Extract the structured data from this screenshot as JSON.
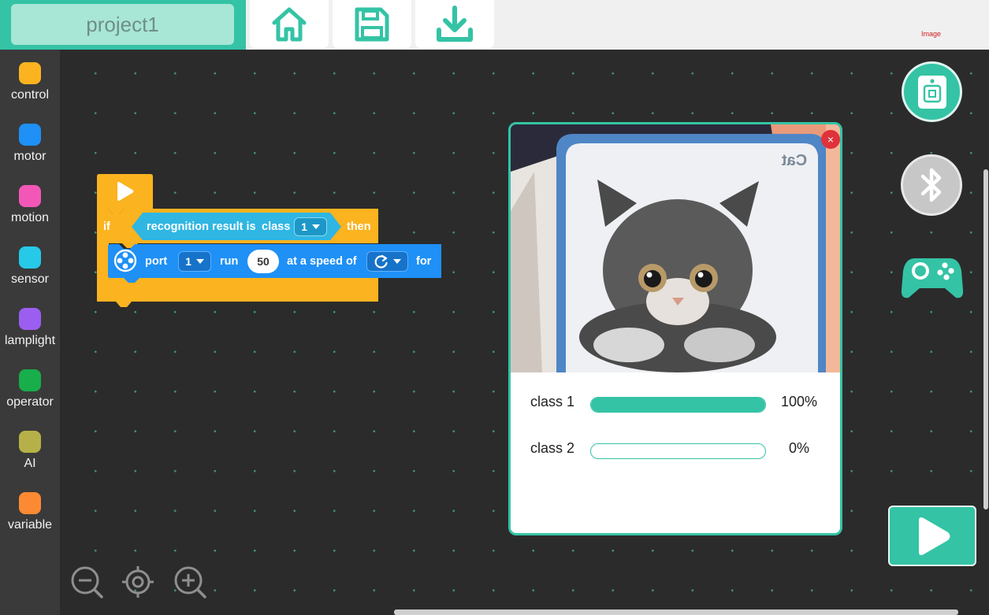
{
  "header": {
    "project_name": "project1",
    "buttons": [
      "home-icon",
      "save-icon",
      "download-icon"
    ],
    "corner_label": "Image"
  },
  "sidebar": {
    "categories": [
      {
        "label": "control",
        "color": "#fbb31f"
      },
      {
        "label": "motor",
        "color": "#1e90f6"
      },
      {
        "label": "motion",
        "color": "#f257b8"
      },
      {
        "label": "sensor",
        "color": "#26c9e8"
      },
      {
        "label": "lamplight",
        "color": "#9c5ef0"
      },
      {
        "label": "operator",
        "color": "#17ae4b"
      },
      {
        "label": "AI",
        "color": "#b5b148"
      },
      {
        "label": "variable",
        "color": "#fc8a33"
      }
    ]
  },
  "blocks": {
    "if_label": "if",
    "condition": "recognition result is",
    "class_word": "class",
    "class_value": "1",
    "then_label": "then",
    "motor": {
      "port_label": "port",
      "port_value": "1",
      "run_label": "run",
      "run_value": "50",
      "speed_label": "at a speed of",
      "for_label": "for"
    }
  },
  "recognition": {
    "card_text": "Cat",
    "close_symbol": "×",
    "results": [
      {
        "label": "class 1",
        "percent_text": "100%",
        "fill": 1.0
      },
      {
        "label": "class 2",
        "percent_text": "0%",
        "fill": 0.0
      }
    ]
  },
  "colors": {
    "accent": "#34c3a5",
    "control_block": "#fbb31f",
    "motor_block": "#1e90f6",
    "condition_block": "#2fb6e3"
  }
}
